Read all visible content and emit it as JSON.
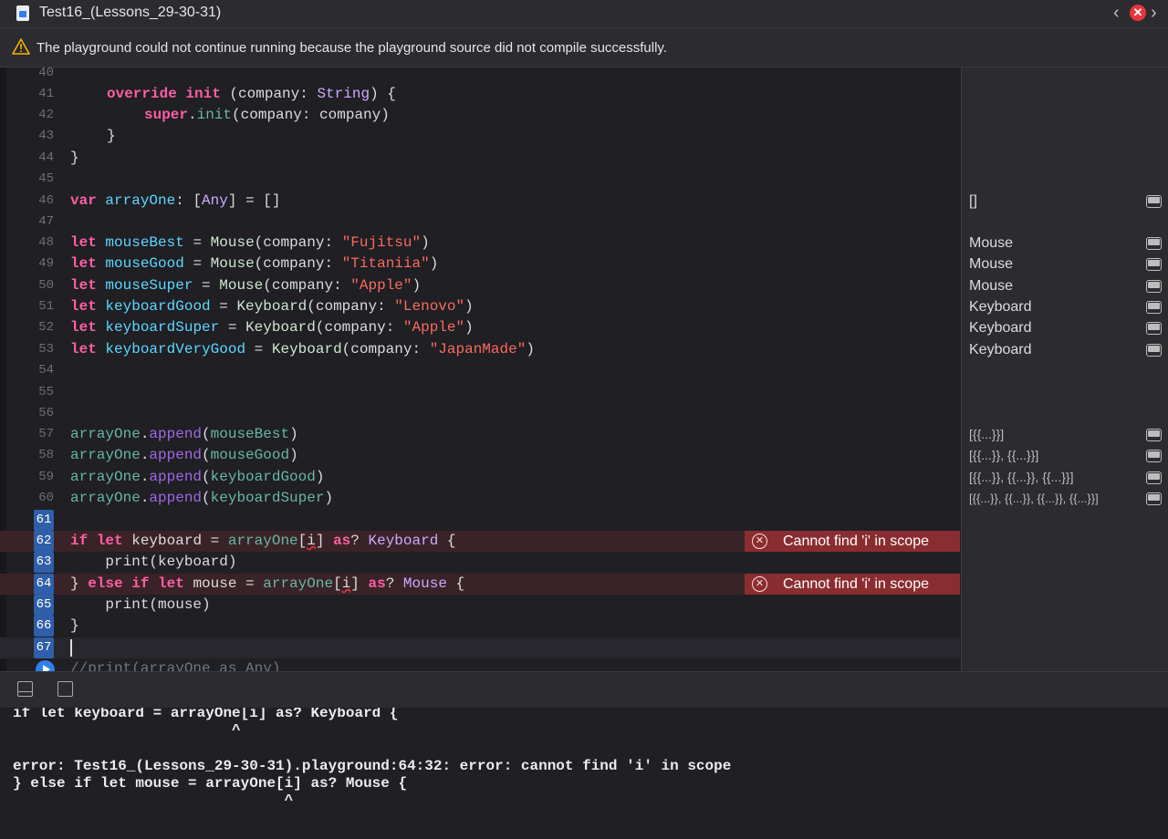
{
  "window": {
    "title": "Test16_(Lessons_29-30-31)",
    "error_badge": "✕"
  },
  "warning": {
    "text": "The playground could not continue running because the playground source did not compile successfully."
  },
  "editor": {
    "line_numbers": [
      "40",
      "41",
      "42",
      "43",
      "44",
      "45",
      "46",
      "47",
      "48",
      "49",
      "50",
      "51",
      "52",
      "53",
      "54",
      "55",
      "56",
      "57",
      "58",
      "59",
      "60",
      "61",
      "62",
      "63",
      "64",
      "65",
      "66",
      "67"
    ],
    "errors": [
      {
        "line": "62",
        "message": "Cannot find 'i' in scope"
      },
      {
        "line": "64",
        "message": "Cannot find 'i' in scope"
      }
    ],
    "code": {
      "l41": {
        "kw1": "override",
        "kw2": "init",
        "rest1": " (company: ",
        "type": "String",
        "rest2": ") {"
      },
      "l42": {
        "kw": "super",
        "rest1": ".",
        "fn": "init",
        "rest2": "(company: company)"
      },
      "l43": "}",
      "l44": "}",
      "l46": {
        "kw": "var",
        "name": "arrayOne",
        "rest1": ": [",
        "type": "Any",
        "rest2": "] = []"
      },
      "l48": {
        "kw": "let",
        "name": "mouseBest",
        "cls": "Mouse",
        "arg": "(company: ",
        "str": "\"Fujitsu\"",
        "close": ")"
      },
      "l49": {
        "kw": "let",
        "name": "mouseGood",
        "cls": "Mouse",
        "arg": "(company: ",
        "str": "\"Titaniia\"",
        "close": ")"
      },
      "l50": {
        "kw": "let",
        "name": "mouseSuper",
        "cls": "Mouse",
        "arg": "(company: ",
        "str": "\"Apple\"",
        "close": ")"
      },
      "l51": {
        "kw": "let",
        "name": "keyboardGood",
        "cls": "Keyboard",
        "arg": "(company: ",
        "str": "\"Lenovo\"",
        "close": ")"
      },
      "l52": {
        "kw": "let",
        "name": "keyboardSuper",
        "cls": "Keyboard",
        "arg": "(company: ",
        "str": "\"Apple\"",
        "close": ")"
      },
      "l53": {
        "kw": "let",
        "name": "keyboardVeryGood",
        "cls": "Keyboard",
        "arg": "(company: ",
        "str": "\"JapanMade\"",
        "close": ")"
      },
      "l57": {
        "obj": "arrayOne",
        "method": "append",
        "arg": "mouseBest"
      },
      "l58": {
        "obj": "arrayOne",
        "method": "append",
        "arg": "mouseGood"
      },
      "l59": {
        "obj": "arrayOne",
        "method": "append",
        "arg": "keyboardGood"
      },
      "l60": {
        "obj": "arrayOne",
        "method": "append",
        "arg": "keyboardSuper"
      },
      "l62": {
        "kw1": "if",
        "kw2": "let",
        "mid1": " keyboard = ",
        "obj": "arrayOne",
        "mid2": "[",
        "idx": "i",
        "mid3": "] ",
        "kw3": "as",
        "mid4": "? ",
        "type": "Keyboard",
        "end": " {"
      },
      "l63": "    print(keyboard)",
      "l64": {
        "pre": "} ",
        "kw1": "else",
        "sp": " ",
        "kw2": "if",
        "kw3": "let",
        "mid1": " mouse = ",
        "obj": "arrayOne",
        "mid2": "[",
        "idx": "i",
        "mid3": "] ",
        "kw4": "as",
        "mid4": "? ",
        "type": "Mouse",
        "end": " {"
      },
      "l65": "    print(mouse)",
      "l66": "}",
      "l68": "//print(arrayOne as Any)"
    }
  },
  "results": [
    {
      "line": "46",
      "value": "[]"
    },
    {
      "line": "48",
      "value": "Mouse"
    },
    {
      "line": "49",
      "value": "Mouse"
    },
    {
      "line": "50",
      "value": "Mouse"
    },
    {
      "line": "51",
      "value": "Keyboard"
    },
    {
      "line": "52",
      "value": "Keyboard"
    },
    {
      "line": "53",
      "value": "Keyboard"
    },
    {
      "line": "57",
      "value": "[{{...}}]"
    },
    {
      "line": "58",
      "value": "[{{...}}, {{...}}]"
    },
    {
      "line": "59",
      "value": "[{{...}}, {{...}}, {{...}}]"
    },
    {
      "line": "60",
      "value": "[{{...}}, {{...}}, {{...}}, {{...}}]"
    }
  ],
  "console": {
    "lines": [
      "if let keyboard = arrayOne[i] as? Keyboard {",
      "                         ^",
      "",
      "error: Test16_(Lessons_29-30-31).playground:64:32: error: cannot find 'i' in scope",
      "} else if let mouse = arrayOne[i] as? Mouse {",
      "                               ^"
    ]
  },
  "colors": {
    "error_badge_bg": "#8a2d30",
    "error_line_bg": "#3a2328",
    "keyword": "#fc5fa3",
    "string": "#fc6a5d",
    "type": "#d0a8ff",
    "selection": "#2f5fa8"
  }
}
